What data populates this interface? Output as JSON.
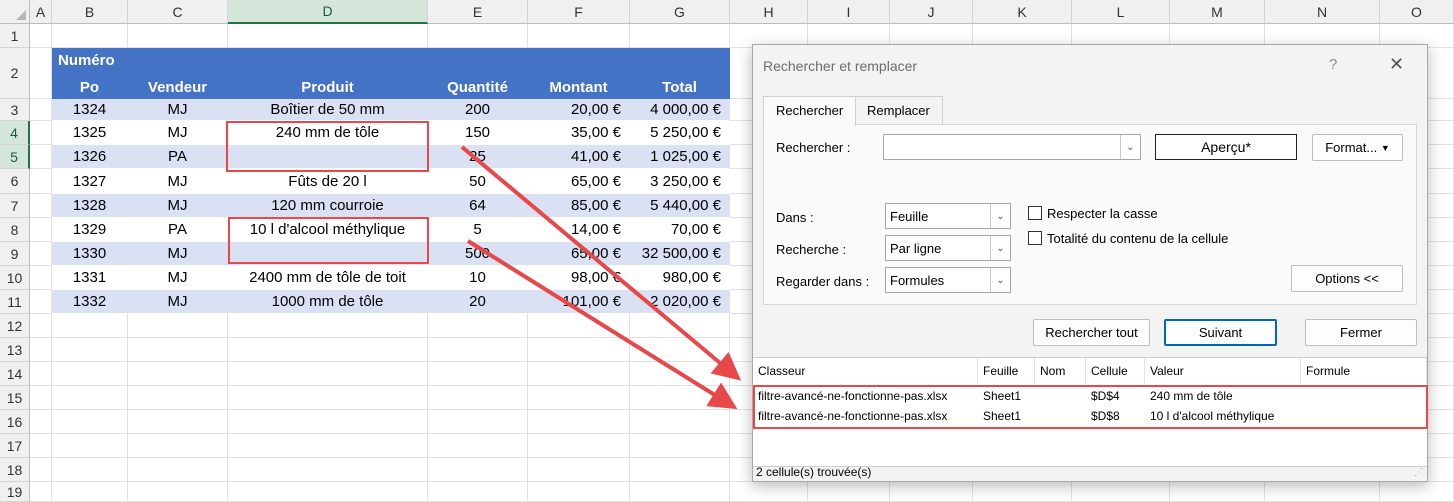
{
  "sheet": {
    "columns": [
      "A",
      "B",
      "C",
      "D",
      "E",
      "F",
      "G",
      "H",
      "I",
      "J",
      "K",
      "L",
      "M",
      "N",
      "O"
    ],
    "rows": [
      "1",
      "2",
      "3",
      "4",
      "5",
      "6",
      "7",
      "8",
      "9",
      "10",
      "11",
      "12",
      "13",
      "14",
      "15",
      "16",
      "17",
      "18",
      "19"
    ],
    "header_top": "Numéro",
    "headers": [
      "Po",
      "Vendeur",
      "Produit",
      "Quantité",
      "Montant",
      "Total"
    ],
    "data": [
      [
        "1324",
        "MJ",
        "Boîtier de 50 mm",
        "200",
        "20,00 €",
        "4 000,00 €"
      ],
      [
        "1325",
        "MJ",
        "240 mm de tôle",
        "150",
        "35,00 €",
        "5 250,00 €"
      ],
      [
        "1326",
        "PA",
        "",
        "25",
        "41,00 €",
        "1 025,00 €"
      ],
      [
        "1327",
        "MJ",
        "Fûts de 20 l",
        "50",
        "65,00 €",
        "3 250,00 €"
      ],
      [
        "1328",
        "MJ",
        "120 mm courroie",
        "64",
        "85,00 €",
        "5 440,00 €"
      ],
      [
        "1329",
        "PA",
        "10 l d'alcool méthylique",
        "5",
        "14,00 €",
        "70,00 €"
      ],
      [
        "1330",
        "MJ",
        "",
        "500",
        "65,00 €",
        "32 500,00 €"
      ],
      [
        "1331",
        "MJ",
        "2400 mm de tôle de toit",
        "10",
        "98,00 €",
        "980,00 €"
      ],
      [
        "1332",
        "MJ",
        "1000 mm de tôle",
        "20",
        "101,00 €",
        "2 020,00 €"
      ]
    ]
  },
  "dialog": {
    "title": "Rechercher et remplacer",
    "help": "?",
    "close": "✕",
    "tabs": [
      "Rechercher",
      "Remplacer"
    ],
    "find_label": "Rechercher :",
    "find_value": "",
    "preview": "Aperçu*",
    "format_button": "Format...",
    "within_label": "Dans :",
    "within_value": "Feuille",
    "search_label": "Recherche :",
    "search_value": "Par ligne",
    "lookin_label": "Regarder dans :",
    "lookin_value": "Formules",
    "match_case": "Respecter la casse",
    "entire_cell": "Totalité du contenu de la cellule",
    "options_button": "Options <<",
    "find_all_button": "Rechercher tout",
    "find_next_button": "Suivant",
    "close_button": "Fermer",
    "results": {
      "columns": [
        "Classeur",
        "Feuille",
        "Nom",
        "Cellule",
        "Valeur",
        "Formule"
      ],
      "rows": [
        [
          "filtre-avancé-ne-fonctionne-pas.xlsx",
          "Sheet1",
          "",
          "$D$4",
          "240 mm de tôle",
          ""
        ],
        [
          "filtre-avancé-ne-fonctionne-pas.xlsx",
          "Sheet1",
          "",
          "$D$8",
          "10 l d'alcool méthylique",
          ""
        ]
      ]
    },
    "status": "2 cellule(s) trouvée(s)"
  },
  "colors": {
    "header_band": "#4472c4",
    "row_band": "#d9e1f2",
    "highlight": "#e8484a",
    "selection": "#217346"
  }
}
